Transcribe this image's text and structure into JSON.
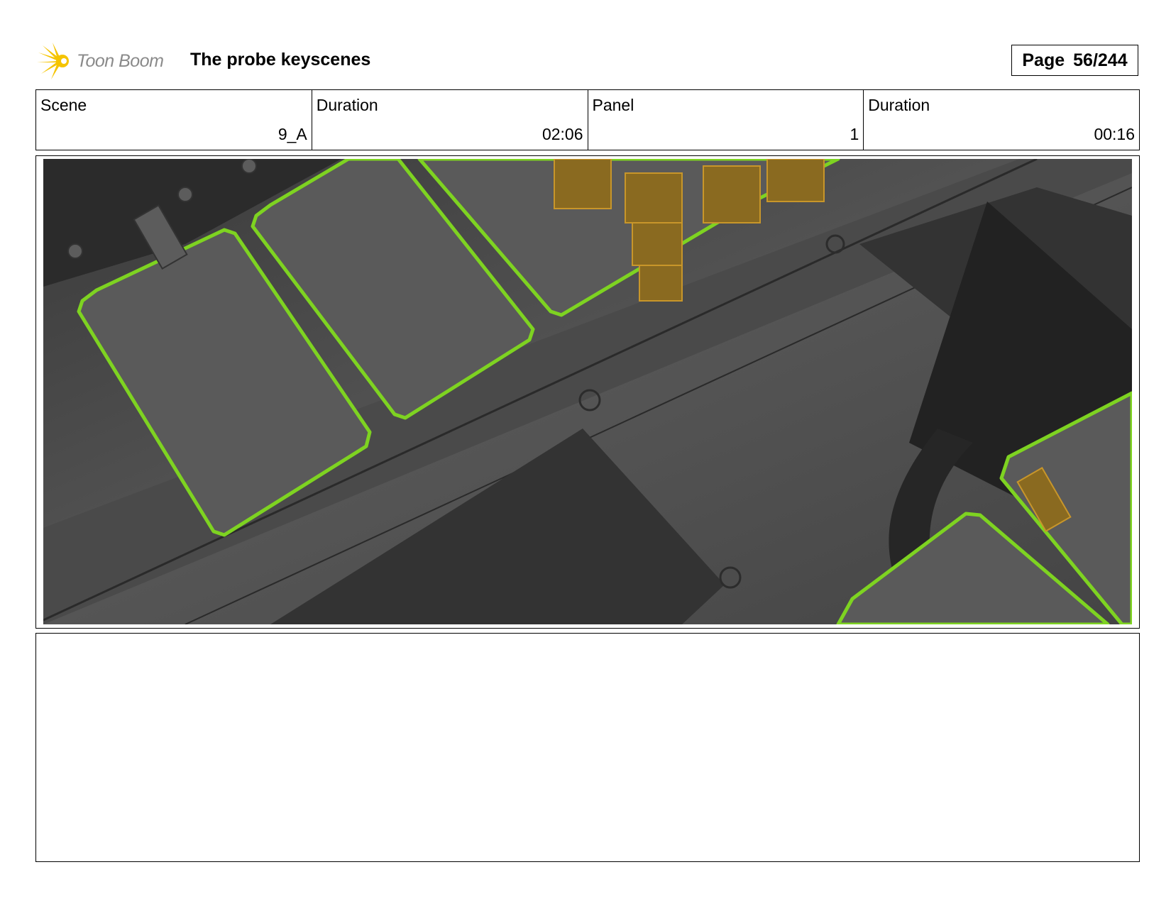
{
  "header": {
    "logo_text": "Toon Boom",
    "title": "The probe keyscenes",
    "page_label": "Page",
    "page_value": "56/244"
  },
  "info": [
    {
      "label": "Scene",
      "value": "9_A"
    },
    {
      "label": "Duration",
      "value": "02:06"
    },
    {
      "label": "Panel",
      "value": "1"
    },
    {
      "label": "Duration",
      "value": "00:16"
    }
  ],
  "colors": {
    "accent_green": "#7ed321",
    "panel_bg": "#4f4f4f",
    "logo_yellow": "#f5c400"
  }
}
